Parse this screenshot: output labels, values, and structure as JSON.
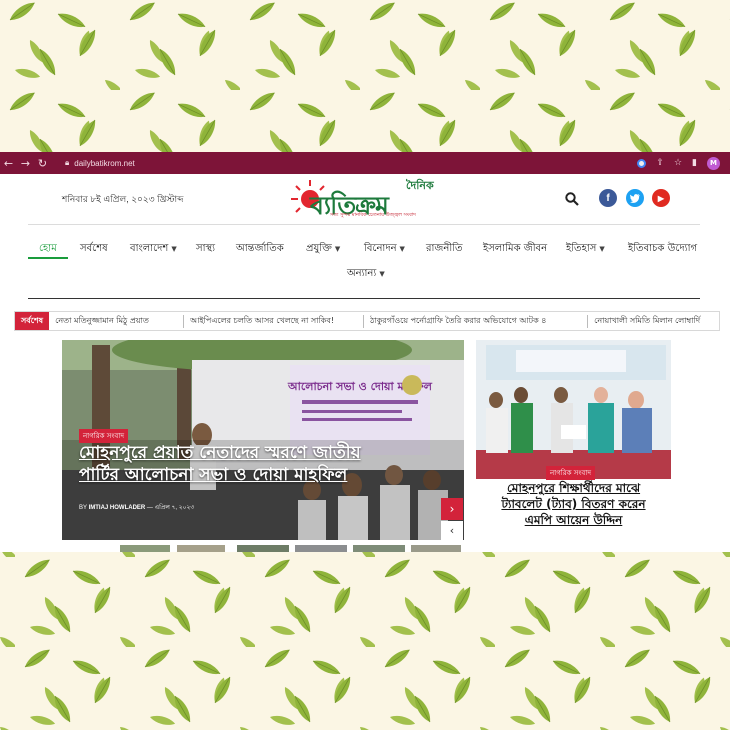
{
  "browser": {
    "url": "dailybatikrom.net",
    "back_icon": "arrow-left",
    "forward_icon": "arrow-right",
    "reload_icon": "reload",
    "profile_initial": "M"
  },
  "header": {
    "date": "শনিবার ৮ই এপ্রিল, ২০২৩ খ্রিস্টাব্দ",
    "logo_small": "দৈনিক",
    "logo_main": "ব্যতিক্রম",
    "logo_tagline": "সত্য সুন্দর মানবিক চেতনায় উজ্জ্বল সংবাদ"
  },
  "menu": {
    "items": [
      {
        "label": "হোম",
        "active": true,
        "dropdown": false
      },
      {
        "label": "সর্বশেষ",
        "dropdown": false
      },
      {
        "label": "বাংলাদেশ",
        "dropdown": true
      },
      {
        "label": "সাস্থ্য",
        "dropdown": false
      },
      {
        "label": "আন্তর্জাতিক",
        "dropdown": false
      },
      {
        "label": "প্রযুক্তি",
        "dropdown": true
      },
      {
        "label": "বিনোদন",
        "dropdown": true
      },
      {
        "label": "রাজনীতি",
        "dropdown": false
      },
      {
        "label": "ইসলামিক জীবন",
        "dropdown": false
      },
      {
        "label": "ইতিহাস",
        "dropdown": true
      },
      {
        "label": "ইতিবাচক উদ্যোগ",
        "dropdown": false
      },
      {
        "label": "অন্যান্য",
        "dropdown": true
      }
    ]
  },
  "ticker": {
    "label": "সর্বশেষ",
    "items": [
      "নেতা মতিনুজ্জামান মিঠু প্রয়াত",
      "আইপিএলের চলতি আসর খেলছে না সাকিব!",
      "ঠাকুরগাঁওয়ে পর্নোগ্রাফি তৈরি করার অভিযোগে আটক ৪",
      "নোয়াখালী সমিতি মিলান লোম্বার্দি"
    ]
  },
  "hero": {
    "category": "নাগরিক সংবাদ",
    "title": "মোহনপুরে প্রয়াত নেতাদের স্মরণে জাতীয় পার্টির আলোচনা সভা ও দোয়া মাহফিল",
    "author_prefix": "BY",
    "author": "IMTIAJ HOWLADER",
    "date": "এপ্রিল ৭, ২০২৩",
    "banner_text": "আলোচনা সভা ও দোয়া মাহফিল"
  },
  "side_story": {
    "category": "নাগরিক সংবাদ",
    "title": "মোহনপুরে শিক্ষার্থীদের মাঝে ট্যাবলেট (ট্যাব) বিতরণ করেন এমপি আয়েন উদ্দিন"
  },
  "colors": {
    "browser_bar": "#7d1438",
    "accent_red": "#d3233a",
    "active_green": "#1a9c3c",
    "background_cream": "#fbf6e4",
    "leaf_green": "#8fb43a"
  }
}
